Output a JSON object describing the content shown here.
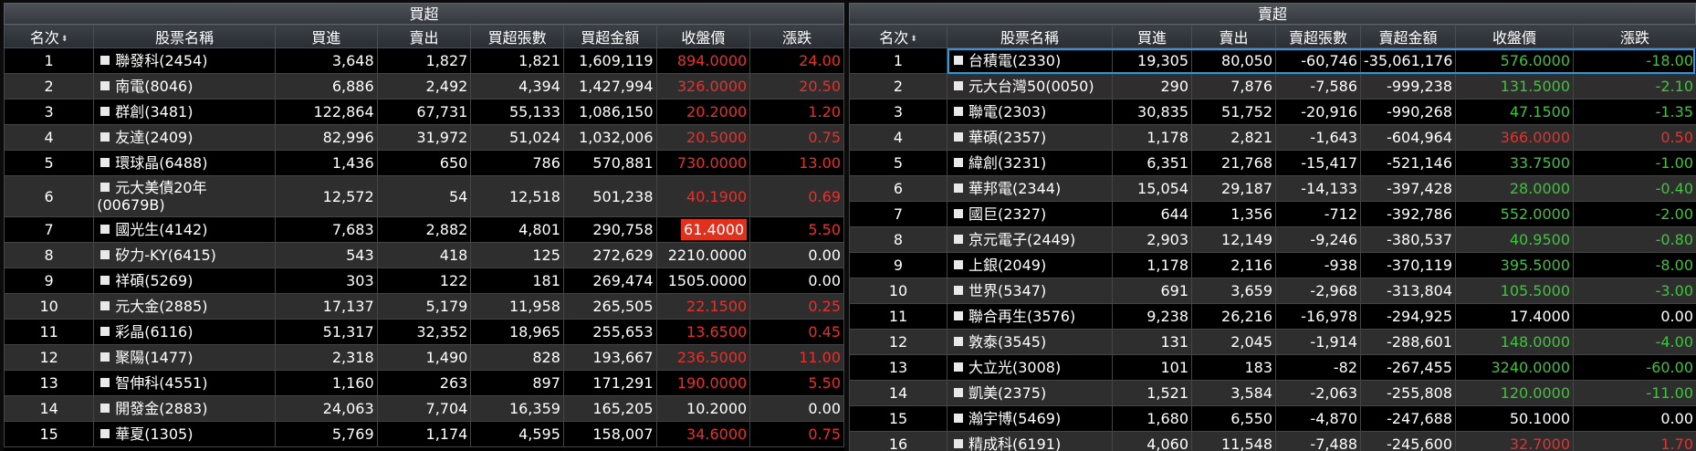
{
  "buy": {
    "title": "買超",
    "columns": {
      "rank": "名次",
      "name": "股票名稱",
      "buy": "買進",
      "sell": "賣出",
      "net_lots": "買超張數",
      "net_amount": "買超金額",
      "close": "收盤價",
      "change": "漲跌"
    },
    "rows": [
      {
        "rank": "1",
        "name": "聯發科(2454)",
        "buy": "3,648",
        "sell": "1,827",
        "net_lots": "1,821",
        "net_amount": "1,609,119",
        "close": "894.0000",
        "change": "24.00",
        "trend": "up"
      },
      {
        "rank": "2",
        "name": "南電(8046)",
        "buy": "6,886",
        "sell": "2,492",
        "net_lots": "4,394",
        "net_amount": "1,427,994",
        "close": "326.0000",
        "change": "20.50",
        "trend": "up"
      },
      {
        "rank": "3",
        "name": "群創(3481)",
        "buy": "122,864",
        "sell": "67,731",
        "net_lots": "55,133",
        "net_amount": "1,086,150",
        "close": "20.2000",
        "change": "1.20",
        "trend": "up"
      },
      {
        "rank": "4",
        "name": "友達(2409)",
        "buy": "82,996",
        "sell": "31,972",
        "net_lots": "51,024",
        "net_amount": "1,032,006",
        "close": "20.5000",
        "change": "0.75",
        "trend": "up"
      },
      {
        "rank": "5",
        "name": "環球晶(6488)",
        "buy": "1,436",
        "sell": "650",
        "net_lots": "786",
        "net_amount": "570,881",
        "close": "730.0000",
        "change": "13.00",
        "trend": "up"
      },
      {
        "rank": "6",
        "name": "元大美債20年(00679B)",
        "buy": "12,572",
        "sell": "54",
        "net_lots": "12,518",
        "net_amount": "501,238",
        "close": "40.1900",
        "change": "0.69",
        "trend": "up",
        "tall": true
      },
      {
        "rank": "7",
        "name": "國光生(4142)",
        "buy": "7,683",
        "sell": "2,882",
        "net_lots": "4,801",
        "net_amount": "290,758",
        "close": "61.4000",
        "change": "5.50",
        "trend": "up",
        "limit": true
      },
      {
        "rank": "8",
        "name": "矽力-KY(6415)",
        "buy": "543",
        "sell": "418",
        "net_lots": "125",
        "net_amount": "272,629",
        "close": "2210.0000",
        "change": "0.00",
        "trend": "flat"
      },
      {
        "rank": "9",
        "name": "祥碩(5269)",
        "buy": "303",
        "sell": "122",
        "net_lots": "181",
        "net_amount": "269,474",
        "close": "1505.0000",
        "change": "0.00",
        "trend": "flat"
      },
      {
        "rank": "10",
        "name": "元大金(2885)",
        "buy": "17,137",
        "sell": "5,179",
        "net_lots": "11,958",
        "net_amount": "265,505",
        "close": "22.1500",
        "change": "0.25",
        "trend": "up"
      },
      {
        "rank": "11",
        "name": "彩晶(6116)",
        "buy": "51,317",
        "sell": "32,352",
        "net_lots": "18,965",
        "net_amount": "255,653",
        "close": "13.6500",
        "change": "0.45",
        "trend": "up"
      },
      {
        "rank": "12",
        "name": "聚陽(1477)",
        "buy": "2,318",
        "sell": "1,490",
        "net_lots": "828",
        "net_amount": "193,667",
        "close": "236.5000",
        "change": "11.00",
        "trend": "up"
      },
      {
        "rank": "13",
        "name": "智伸科(4551)",
        "buy": "1,160",
        "sell": "263",
        "net_lots": "897",
        "net_amount": "171,291",
        "close": "190.0000",
        "change": "5.50",
        "trend": "up"
      },
      {
        "rank": "14",
        "name": "開發金(2883)",
        "buy": "24,063",
        "sell": "7,704",
        "net_lots": "16,359",
        "net_amount": "165,205",
        "close": "10.2000",
        "change": "0.00",
        "trend": "flat"
      },
      {
        "rank": "15",
        "name": "華夏(1305)",
        "buy": "5,769",
        "sell": "1,174",
        "net_lots": "4,595",
        "net_amount": "158,007",
        "close": "34.6000",
        "change": "0.75",
        "trend": "up"
      }
    ]
  },
  "sell": {
    "title": "賣超",
    "columns": {
      "rank": "名次",
      "name": "股票名稱",
      "buy": "買進",
      "sell": "賣出",
      "net_lots": "賣超張數",
      "net_amount": "賣超金額",
      "close": "收盤價",
      "change": "漲跌"
    },
    "rows": [
      {
        "rank": "1",
        "name": "台積電(2330)",
        "buy": "19,305",
        "sell": "80,050",
        "net_lots": "-60,746",
        "net_amount": "-35,061,176",
        "close": "576.0000",
        "change": "-18.00",
        "trend": "down",
        "selected": true
      },
      {
        "rank": "2",
        "name": "元大台灣50(0050)",
        "buy": "290",
        "sell": "7,876",
        "net_lots": "-7,586",
        "net_amount": "-999,238",
        "close": "131.5000",
        "change": "-2.10",
        "trend": "down"
      },
      {
        "rank": "3",
        "name": "聯電(2303)",
        "buy": "30,835",
        "sell": "51,752",
        "net_lots": "-20,916",
        "net_amount": "-990,268",
        "close": "47.1500",
        "change": "-1.35",
        "trend": "down"
      },
      {
        "rank": "4",
        "name": "華碩(2357)",
        "buy": "1,178",
        "sell": "2,821",
        "net_lots": "-1,643",
        "net_amount": "-604,964",
        "close": "366.0000",
        "change": "0.50",
        "trend": "up"
      },
      {
        "rank": "5",
        "name": "緯創(3231)",
        "buy": "6,351",
        "sell": "21,768",
        "net_lots": "-15,417",
        "net_amount": "-521,146",
        "close": "33.7500",
        "change": "-1.00",
        "trend": "down"
      },
      {
        "rank": "6",
        "name": "華邦電(2344)",
        "buy": "15,054",
        "sell": "29,187",
        "net_lots": "-14,133",
        "net_amount": "-397,428",
        "close": "28.0000",
        "change": "-0.40",
        "trend": "down"
      },
      {
        "rank": "7",
        "name": "國巨(2327)",
        "buy": "644",
        "sell": "1,356",
        "net_lots": "-712",
        "net_amount": "-392,786",
        "close": "552.0000",
        "change": "-2.00",
        "trend": "down"
      },
      {
        "rank": "8",
        "name": "京元電子(2449)",
        "buy": "2,903",
        "sell": "12,149",
        "net_lots": "-9,246",
        "net_amount": "-380,537",
        "close": "40.9500",
        "change": "-0.80",
        "trend": "down"
      },
      {
        "rank": "9",
        "name": "上銀(2049)",
        "buy": "1,178",
        "sell": "2,116",
        "net_lots": "-938",
        "net_amount": "-370,119",
        "close": "395.5000",
        "change": "-8.00",
        "trend": "down"
      },
      {
        "rank": "10",
        "name": "世界(5347)",
        "buy": "691",
        "sell": "3,659",
        "net_lots": "-2,968",
        "net_amount": "-313,804",
        "close": "105.5000",
        "change": "-3.00",
        "trend": "down"
      },
      {
        "rank": "11",
        "name": "聯合再生(3576)",
        "buy": "9,238",
        "sell": "26,216",
        "net_lots": "-16,978",
        "net_amount": "-294,925",
        "close": "17.4000",
        "change": "0.00",
        "trend": "flat"
      },
      {
        "rank": "12",
        "name": "敦泰(3545)",
        "buy": "131",
        "sell": "2,045",
        "net_lots": "-1,914",
        "net_amount": "-288,601",
        "close": "148.0000",
        "change": "-4.00",
        "trend": "down"
      },
      {
        "rank": "13",
        "name": "大立光(3008)",
        "buy": "101",
        "sell": "183",
        "net_lots": "-82",
        "net_amount": "-267,455",
        "close": "3240.0000",
        "change": "-60.00",
        "trend": "down"
      },
      {
        "rank": "14",
        "name": "凱美(2375)",
        "buy": "1,521",
        "sell": "3,584",
        "net_lots": "-2,063",
        "net_amount": "-255,808",
        "close": "120.0000",
        "change": "-11.00",
        "trend": "down"
      },
      {
        "rank": "15",
        "name": "瀚宇博(5469)",
        "buy": "1,680",
        "sell": "6,550",
        "net_lots": "-4,870",
        "net_amount": "-247,688",
        "close": "50.1000",
        "change": "0.00",
        "trend": "flat"
      },
      {
        "rank": "16",
        "name": "精成科(6191)",
        "buy": "4,060",
        "sell": "11,548",
        "net_lots": "-7,488",
        "net_amount": "-245,600",
        "close": "32.7000",
        "change": "1.70",
        "trend": "up"
      }
    ]
  },
  "colors": {
    "up": "#e8302a",
    "down": "#3ec43a",
    "flat": "#ffffff",
    "selected_border": "#2a9ae0",
    "limit_bg": "#e0301e"
  },
  "icons": {
    "sort": "sort-updown-icon",
    "checkbox": "checkbox-icon"
  }
}
